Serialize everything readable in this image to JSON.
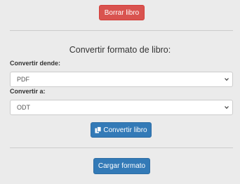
{
  "actions": {
    "delete_book_label": "Borrar libro"
  },
  "convert": {
    "title": "Convertir formato de libro:",
    "from_label": "Convertir dende:",
    "from_value": "PDF",
    "to_label": "Convertir a:",
    "to_value": "ODT",
    "convert_button_label": "Convertir libro",
    "convert_button_icon": "copy-icon"
  },
  "upload": {
    "load_format_label": "Cargar formato"
  },
  "colors": {
    "background": "#ebebeb",
    "danger": "#d9534f",
    "primary": "#337ab7",
    "divider": "#cccccc"
  }
}
